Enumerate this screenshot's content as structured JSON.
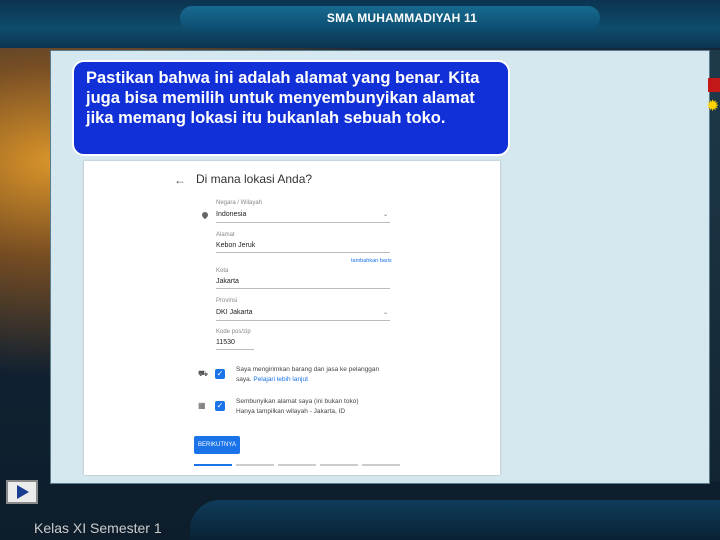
{
  "header": {
    "school": "SMA MUHAMMADIYAH 11"
  },
  "note": {
    "text": "Pastikan bahwa ini adalah alamat yang benar. Kita juga bisa memilih untuk menyembunyikan alamat jika memang lokasi itu bukanlah sebuah toko."
  },
  "form": {
    "back_icon": "arrow-left-icon",
    "title": "Di mana lokasi Anda?",
    "country": {
      "label": "Negara / Wilayah",
      "value": "Indonesia"
    },
    "address": {
      "label": "Alamat",
      "value": "Kebon Jeruk"
    },
    "add_line_link": "tambahkan baris",
    "city": {
      "label": "Kota",
      "value": "Jakarta"
    },
    "province": {
      "label": "Provinsi",
      "value": "DKI Jakarta"
    },
    "postal": {
      "label": "Kode pos/zip",
      "value": "11530"
    },
    "deliver": {
      "text": "Saya mengirimkan barang dan jasa ke pelanggan saya.",
      "link": "Pelajari lebih lanjut",
      "checked": true
    },
    "hide": {
      "text1": "Sembunyikan alamat saya (ini bukan toko)",
      "text2": "Hanya tampilkan wilayah - Jakarta, ID",
      "checked": true
    },
    "next_button": "BERIKUTNYA",
    "steps_total": 5,
    "step_current": 1
  },
  "footer": {
    "label": "Kelas XI Semester 1"
  },
  "colors": {
    "note_bg": "#1230d8",
    "accent": "#1a73e8"
  }
}
